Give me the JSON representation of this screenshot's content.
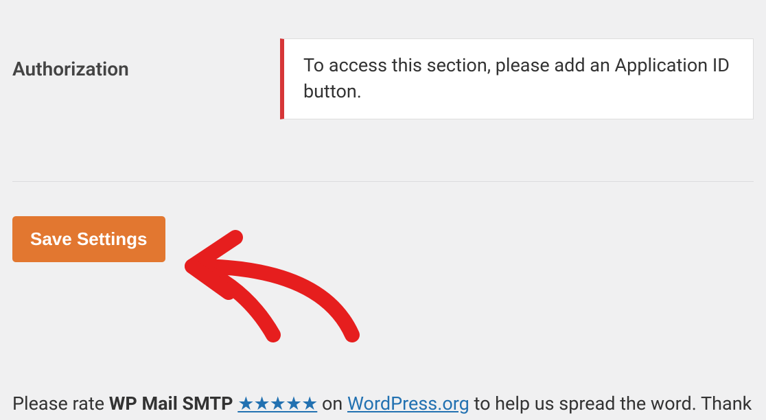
{
  "section": {
    "label": "Authorization",
    "notice": "To access this section, please add an Application ID button."
  },
  "actions": {
    "save_label": "Save Settings"
  },
  "footer": {
    "prefix": "Please rate ",
    "product": "WP Mail SMTP",
    "stars": "★★★★★",
    "on": " on ",
    "link_text": "WordPress.org",
    "suffix": " to help us spread the word. Thank "
  }
}
